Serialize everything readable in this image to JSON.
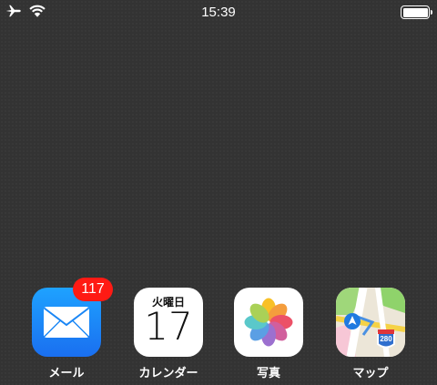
{
  "status_bar": {
    "time": "15:39",
    "icons": [
      "airplane-icon",
      "wifi-icon",
      "battery-icon"
    ],
    "battery_level": 1.0
  },
  "dock": {
    "apps": [
      {
        "label": "メール",
        "icon": "mail-icon",
        "badge": "117"
      },
      {
        "label": "カレンダー",
        "icon": "calendar-icon",
        "weekday": "火曜日",
        "day": "17"
      },
      {
        "label": "写真",
        "icon": "photos-icon"
      },
      {
        "label": "マップ",
        "icon": "maps-icon",
        "route_sign": "280"
      }
    ]
  },
  "colors": {
    "wallpaper": "#333333",
    "badge": "#ff1a14",
    "mail_blue": "#1a8cff"
  }
}
